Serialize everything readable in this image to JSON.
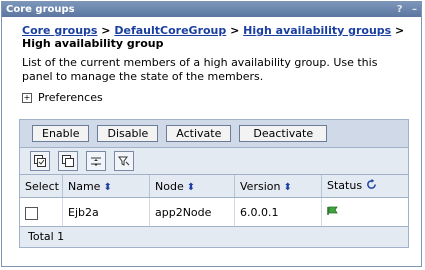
{
  "window": {
    "title": "Core groups",
    "help": "?",
    "minimize": "–"
  },
  "breadcrumb": {
    "items": [
      "Core groups",
      "DefaultCoreGroup",
      "High availability groups"
    ],
    "separator": ">",
    "current": "High availability group"
  },
  "description": "List of the current members of a high availability group. Use this panel to manage the state of the members.",
  "preferences": {
    "toggle": "+",
    "label": "Preferences"
  },
  "toolbar": {
    "buttons": [
      "Enable",
      "Disable",
      "Activate",
      "Deactivate"
    ]
  },
  "icon_toolbar": [
    "select-all-icon",
    "deselect-all-icon",
    "move-icon",
    "filter-icon"
  ],
  "table": {
    "columns": [
      "Select",
      "Name",
      "Node",
      "Version",
      "Status"
    ],
    "rows": [
      {
        "name": "Ejb2a",
        "node": "app2Node",
        "version": "6.0.0.1",
        "status": "running-icon"
      }
    ],
    "total": "Total 1"
  },
  "colors": {
    "titlebar": "#5b76a0",
    "link": "#1a3fa0",
    "header_bg": "#e4eaf2",
    "toolbar_bg": "#cfd9e8"
  }
}
